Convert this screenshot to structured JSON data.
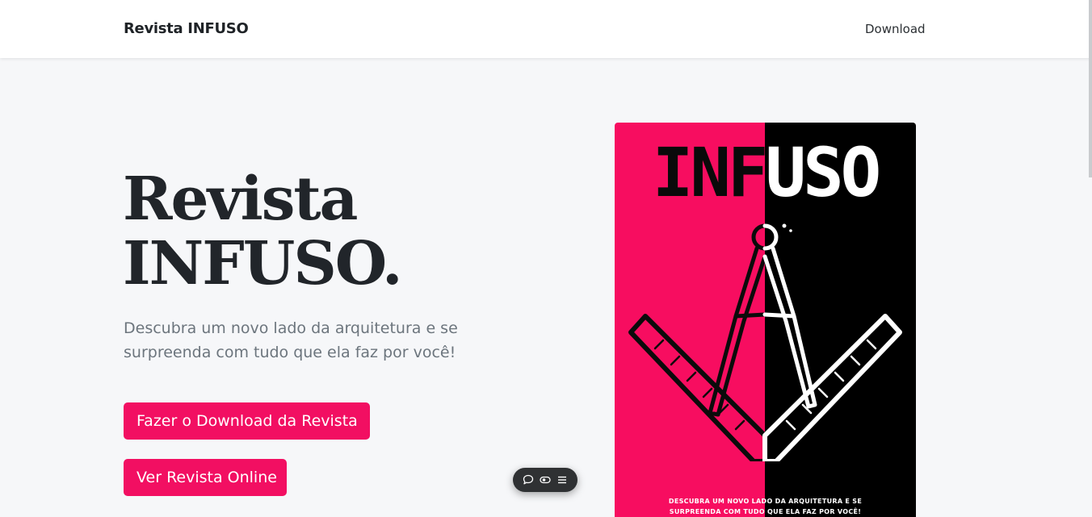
{
  "navbar": {
    "brand": "Revista INFUSO",
    "download_link": "Download"
  },
  "hero": {
    "title_line1": "Revista",
    "title_line2": "INFUSO.",
    "subtitle": "Descubra um novo lado da arquitetura e se surpreenda com tudo que ela faz por você!",
    "download_button": "Fazer o Download da Revista",
    "online_button": "Ver Revista Online"
  },
  "cover": {
    "title_dark": "INF",
    "title_light": "USO",
    "tagline": "DESCUBRA UM NOVO LADO DA ARQUITETURA E SE SURPREENDA COM TUDO QUE ELA FAZ POR VOCÊ!"
  },
  "floating_toolbar": {
    "icons": [
      "comment-icon",
      "eye-icon",
      "menu-icon"
    ]
  },
  "colors": {
    "accent": "#f20f62",
    "cover_pink": "#f70d60",
    "cover_black": "#000000",
    "background": "#f6f7f9",
    "navbar": "#ffffff"
  }
}
